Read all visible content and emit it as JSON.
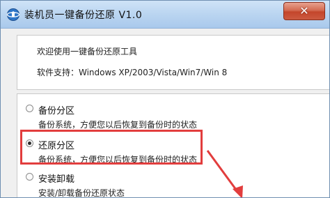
{
  "window": {
    "title": "装机员一键备份还原 V1.0",
    "close_label": "✕"
  },
  "info": {
    "welcome": "欢迎使用一键备份还原工具",
    "support": "软件支持：Windows XP/2003/Vista/Win7/Win 8"
  },
  "options": [
    {
      "label": "备份分区",
      "desc": "备份系统，方便您以后恢复到备份时的状态",
      "checked": false
    },
    {
      "label": "还原分区",
      "desc": "备份系统，方便您以后恢复到备份时的状态",
      "checked": true
    },
    {
      "label": "安装卸载",
      "desc": "安装/卸载备份还原状态",
      "checked": false
    }
  ],
  "colors": {
    "highlight": "#e23d3d",
    "close_button": "#c4462b"
  }
}
